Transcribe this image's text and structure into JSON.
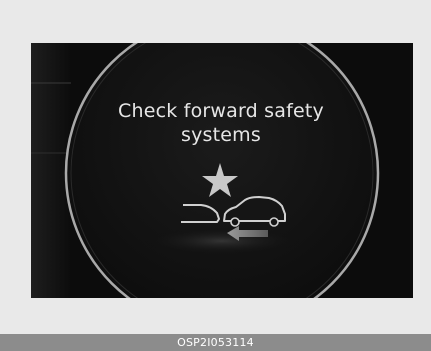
{
  "display": {
    "message_line_1": "Check forward safety",
    "message_line_2": "systems",
    "icon": "forward-collision-warning-icon",
    "text_color": "#e6e6e6",
    "background_color": "#0c0c0c"
  },
  "caption": {
    "code": "OSP2I053114"
  }
}
